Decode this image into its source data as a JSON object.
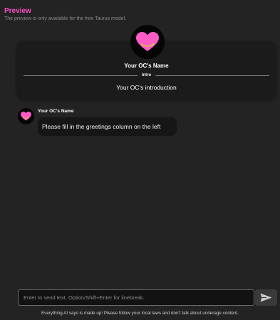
{
  "header": {
    "title": "Preview",
    "subtitle": "The preview is only available for the free Taurus model."
  },
  "profile_card": {
    "name": "Your OC's Name",
    "intro_label": "Intro",
    "intro_text": "Your OC's introduction",
    "avatar_icon": "heart-icon"
  },
  "message": {
    "sender": "Your OC's Name",
    "text": "Please fill in the greetings column on the left",
    "avatar_icon": "heart-icon"
  },
  "composer": {
    "placeholder": "Enter to send text. Option/Shift+Enter for linebreak.",
    "send_icon": "send-icon"
  },
  "footer": {
    "disclaimer": "Everything AI says is made up! Please follow your local laws and don't talk about underage content."
  },
  "colors": {
    "accent": "#ff4fc8",
    "heart": "#ff5cc6",
    "heart_stroke": "#d9c23a",
    "background": "#232323",
    "card": "#1b1b1b"
  }
}
